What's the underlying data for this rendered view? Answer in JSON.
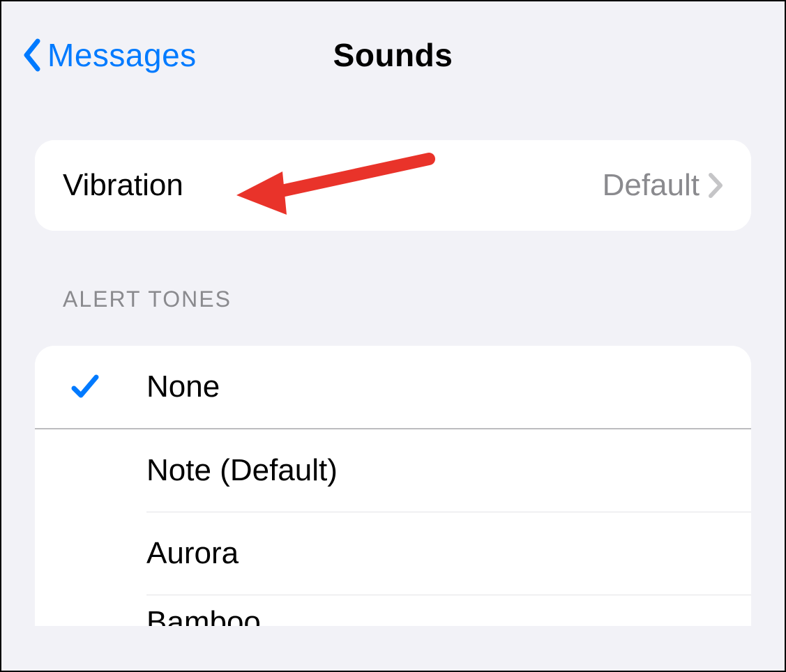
{
  "header": {
    "back_label": "Messages",
    "title": "Sounds"
  },
  "vibration": {
    "label": "Vibration",
    "value": "Default"
  },
  "alert_tones": {
    "header": "ALERT TONES",
    "items": [
      {
        "label": "None",
        "selected": true
      },
      {
        "label": "Note (Default)",
        "selected": false
      },
      {
        "label": "Aurora",
        "selected": false
      },
      {
        "label": "Bamboo",
        "selected": false
      }
    ]
  },
  "colors": {
    "accent": "#007aff",
    "annotation": "#e9332a",
    "secondary_text": "#8a8a8e",
    "background": "#f2f2f7"
  }
}
